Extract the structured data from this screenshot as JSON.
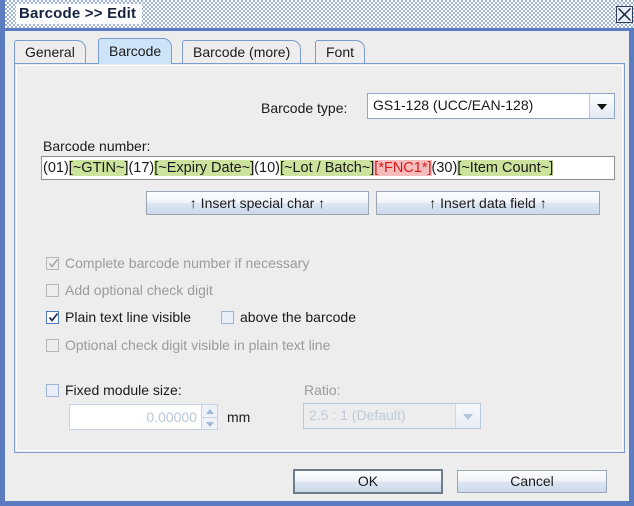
{
  "window": {
    "title": "Barcode >> Edit",
    "close_icon": "close-x-icon"
  },
  "tabs": [
    {
      "label": "General",
      "selected": false
    },
    {
      "label": "Barcode",
      "selected": true
    },
    {
      "label": "Barcode (more)",
      "selected": false
    },
    {
      "label": "Font",
      "selected": false
    }
  ],
  "barcode_type": {
    "label": "Barcode type:",
    "value": "GS1-128 (UCC/EAN-128)",
    "arrow_icon": "chevron-down-icon"
  },
  "barcode_number": {
    "label": "Barcode number:",
    "segments": [
      {
        "text": "(01)",
        "kind": "plain"
      },
      {
        "text": "[~GTIN~]",
        "kind": "field"
      },
      {
        "text": "(17)",
        "kind": "plain"
      },
      {
        "text": "[~Expiry Date~]",
        "kind": "field"
      },
      {
        "text": "(10)",
        "kind": "plain"
      },
      {
        "text": "[~Lot / Batch~]",
        "kind": "field"
      },
      {
        "text": "[*FNC1*]",
        "kind": "special"
      },
      {
        "text": "(30)",
        "kind": "plain"
      },
      {
        "text": "[~Item Count~]",
        "kind": "field"
      }
    ],
    "value": "(01)[~GTIN~](17)[~Expiry Date~](10)[~Lot / Batch~][*FNC1*](30)[~Item Count~]"
  },
  "insert_buttons": {
    "special_char": "↑ Insert special char ↑",
    "data_field": "↑ Insert data field ↑"
  },
  "options": [
    {
      "label": "Complete barcode number if necessary",
      "checked": true,
      "enabled": false
    },
    {
      "label": "Add optional check digit",
      "checked": false,
      "enabled": false
    },
    {
      "label": "Plain text line visible",
      "checked": true,
      "enabled": true
    },
    {
      "label": "above the barcode",
      "checked": false,
      "enabled": true
    },
    {
      "label": "Optional check digit visible in plain text line",
      "checked": false,
      "enabled": false
    }
  ],
  "module_size": {
    "checkbox_label": "Fixed module size:",
    "checked": false,
    "value": "0.00000",
    "unit": "mm",
    "spinner_up_icon": "triangle-up-icon",
    "spinner_down_icon": "triangle-down-icon"
  },
  "ratio": {
    "label": "Ratio:",
    "value": "2.5 : 1  (Default)",
    "arrow_icon": "chevron-down-icon"
  },
  "footer": {
    "ok": "OK",
    "cancel": "Cancel"
  },
  "colors": {
    "window_border": "#5b7cc0",
    "panel_bg": "#ededed",
    "tab_selected": "#cde3f7",
    "field_highlight": "#cbe39c",
    "special_highlight": "#f7bdbd",
    "special_text": "#d61a1a"
  }
}
